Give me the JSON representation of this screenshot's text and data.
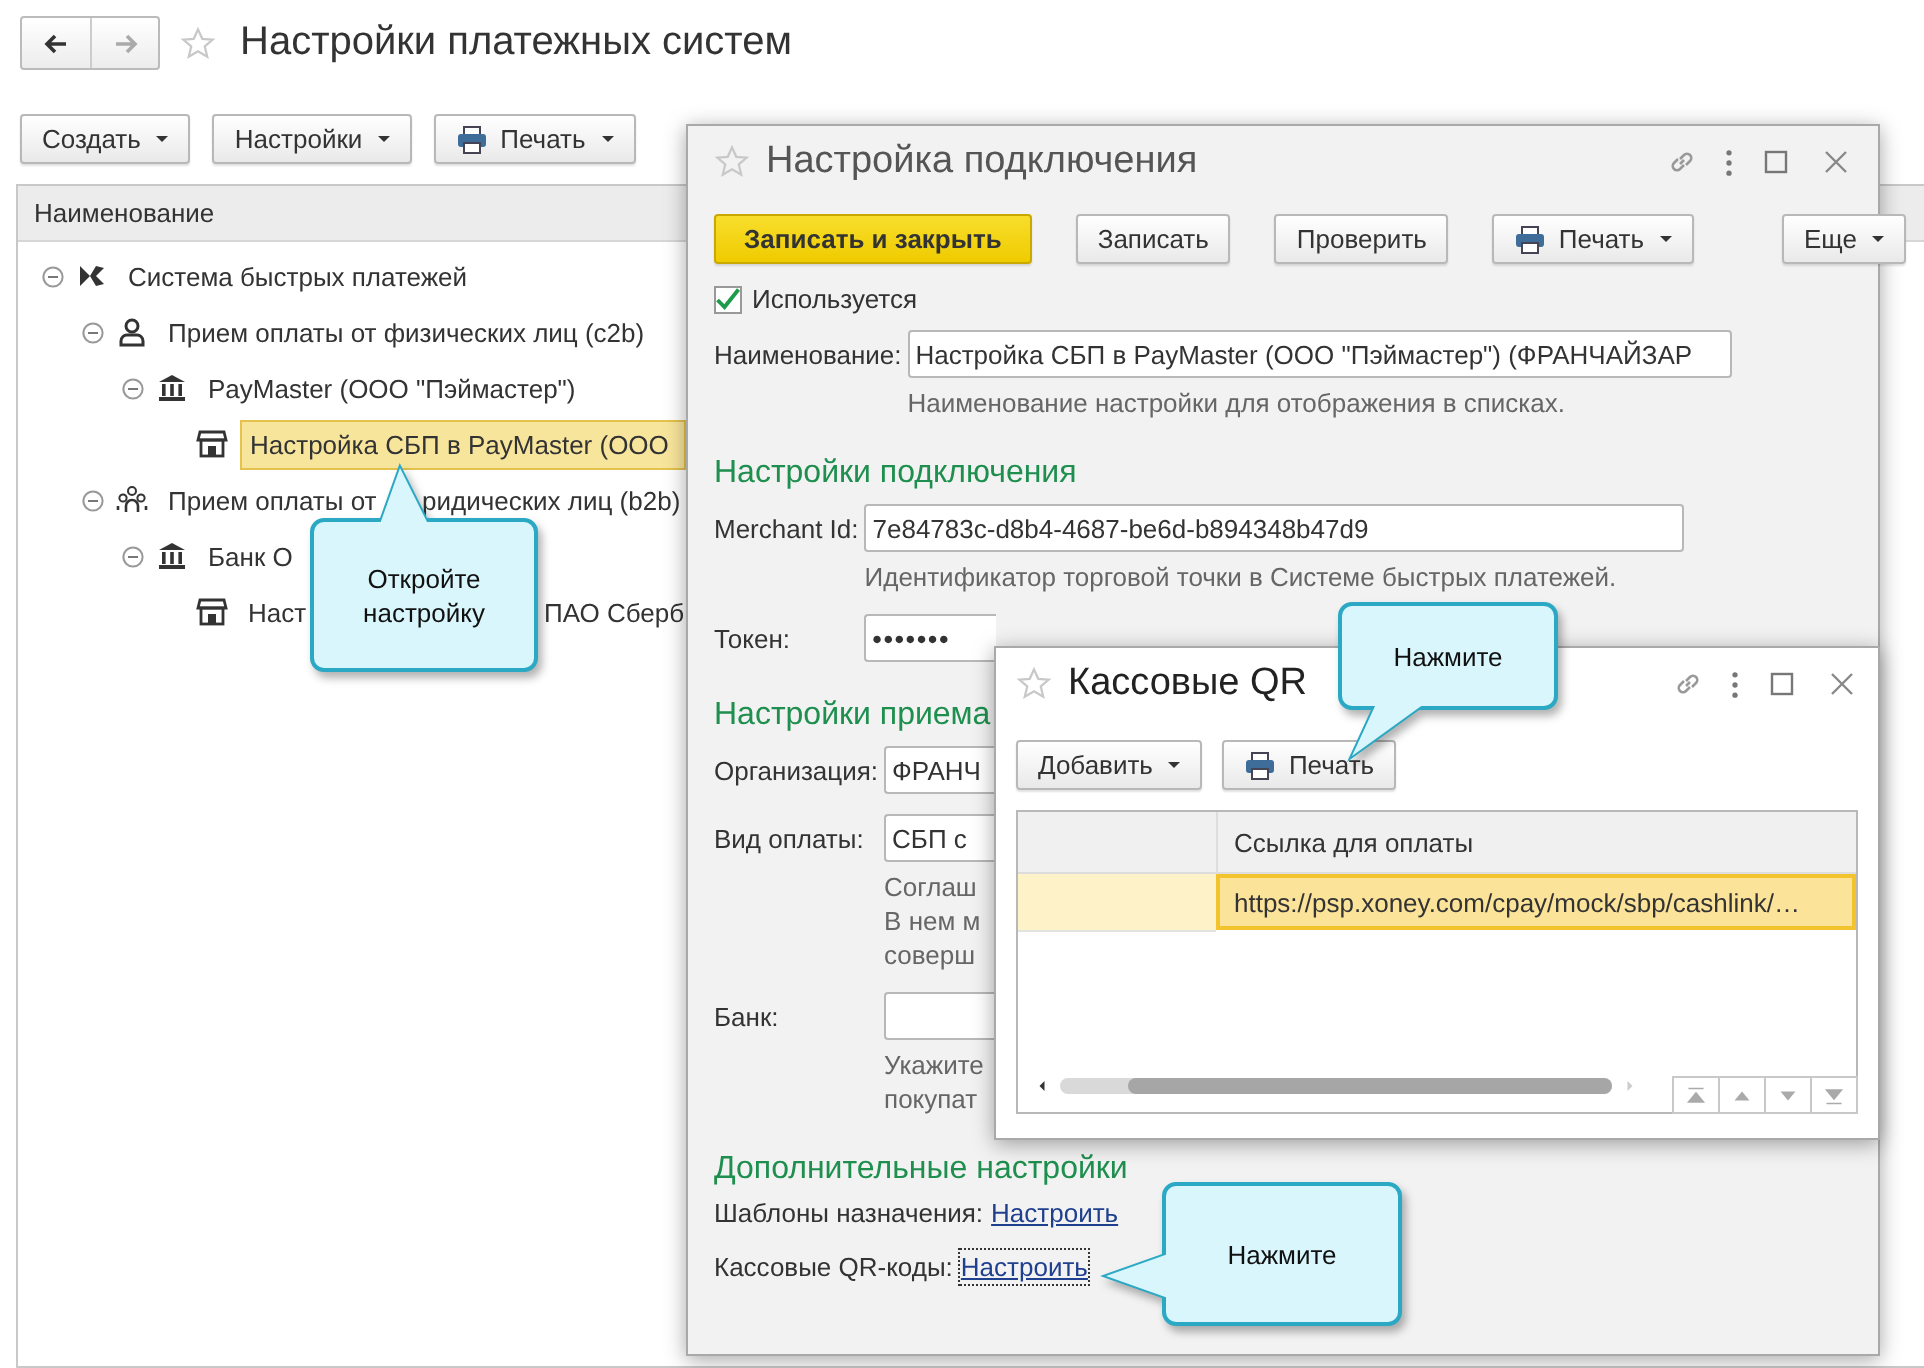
{
  "page": {
    "title": "Настройки платежных систем",
    "toolbar": [
      {
        "label": "Создать",
        "kind": "menu"
      },
      {
        "label": "Настройки",
        "kind": "menu"
      },
      {
        "label": "Печать",
        "kind": "print-menu"
      }
    ],
    "tree": {
      "column": "Наименование",
      "items": [
        {
          "label": "Система быстрых платежей",
          "kind": "sbp",
          "expanded": true,
          "selected": false,
          "children": [
            {
              "label": "Прием оплаты от физических лиц (c2b)",
              "kind": "person",
              "expanded": true,
              "selected": false,
              "children": [
                {
                  "label": "PayMaster (ООО \"Пэймастер\")",
                  "kind": "bank",
                  "expanded": true,
                  "selected": false,
                  "children": [
                    {
                      "label": "Настройка СБП в PayMaster (ООО",
                      "kind": "store",
                      "selected": true
                    }
                  ]
                }
              ]
            },
            {
              "label": "Прием оплаты от",
              "tail": "ридических лиц (b2b)",
              "kind": "group",
              "expanded": true,
              "selected": false,
              "children": [
                {
                  "label": "Банк О",
                  "kind": "bank",
                  "expanded": true,
                  "selected": false,
                  "children": [
                    {
                      "label": "Наст",
                      "tail": "ПАО Сберб",
                      "kind": "store",
                      "selected": false
                    }
                  ]
                }
              ]
            }
          ]
        }
      ]
    }
  },
  "connection_window": {
    "title": "Настройка подключения",
    "buttons": [
      {
        "label": "Записать и закрыть",
        "kind": "primary"
      },
      {
        "label": "Записать",
        "kind": "plain"
      },
      {
        "label": "Проверить",
        "kind": "plain"
      },
      {
        "label": "Печать",
        "kind": "print-menu"
      }
    ],
    "more_menu": {
      "label": "Еще"
    },
    "used": {
      "label": "Используется",
      "checked": true
    },
    "sections": [
      {
        "rows": [
          {
            "kind": "field",
            "label": "Наименование:",
            "value": "Настройка СБП в PayMaster (ООО \"Пэймастер\") (ФРАНЧАЙЗАР",
            "hint": [
              "Наименование настройки для отображения в списках."
            ]
          }
        ]
      },
      {
        "heading": "Настройки подключения",
        "rows": [
          {
            "kind": "field",
            "label": "Merchant Id:",
            "value": "7e84783c-d8b4-4687-be6d-b894348b47d9",
            "hint": [
              "Идентификатор торговой точки в Системе быстрых платежей."
            ]
          },
          {
            "kind": "field",
            "label": "Токен:",
            "value": "•••••••"
          }
        ]
      },
      {
        "heading": "Настройки приема",
        "rows": [
          {
            "kind": "field",
            "label": "Организация:",
            "value": "ФРАНЧ"
          },
          {
            "kind": "field",
            "label": "Вид оплаты:",
            "value": "СБП с",
            "hint": [
              "Соглаш",
              "В нем м",
              "соверш"
            ]
          },
          {
            "kind": "field",
            "label": "Банк:",
            "hint": [
              "Укажите",
              "покупат"
            ]
          }
        ]
      },
      {
        "heading": "Дополнительные настройки",
        "rows": [
          {
            "kind": "link",
            "label": "Шаблоны назначения:",
            "link": "Настроить",
            "focused": false
          },
          {
            "kind": "link",
            "label": "Кассовые QR-коды:",
            "link": "Настроить",
            "focused": true
          }
        ]
      }
    ]
  },
  "qr_window": {
    "title": "Кассовые QR",
    "buttons": [
      {
        "label": "Добавить",
        "kind": "menu"
      },
      {
        "label": "Печать",
        "kind": "print"
      }
    ],
    "columns": [
      {
        "label": "Ссылка для оплаты"
      }
    ],
    "rows": [
      {
        "link": "https://psp.xoney.com/cpay/mock/sbp/cashlink/…",
        "selected": true
      }
    ]
  },
  "callouts": [
    {
      "text": "Откройте настройку"
    },
    {
      "text": "Нажмите"
    },
    {
      "text": "Нажмите"
    }
  ]
}
